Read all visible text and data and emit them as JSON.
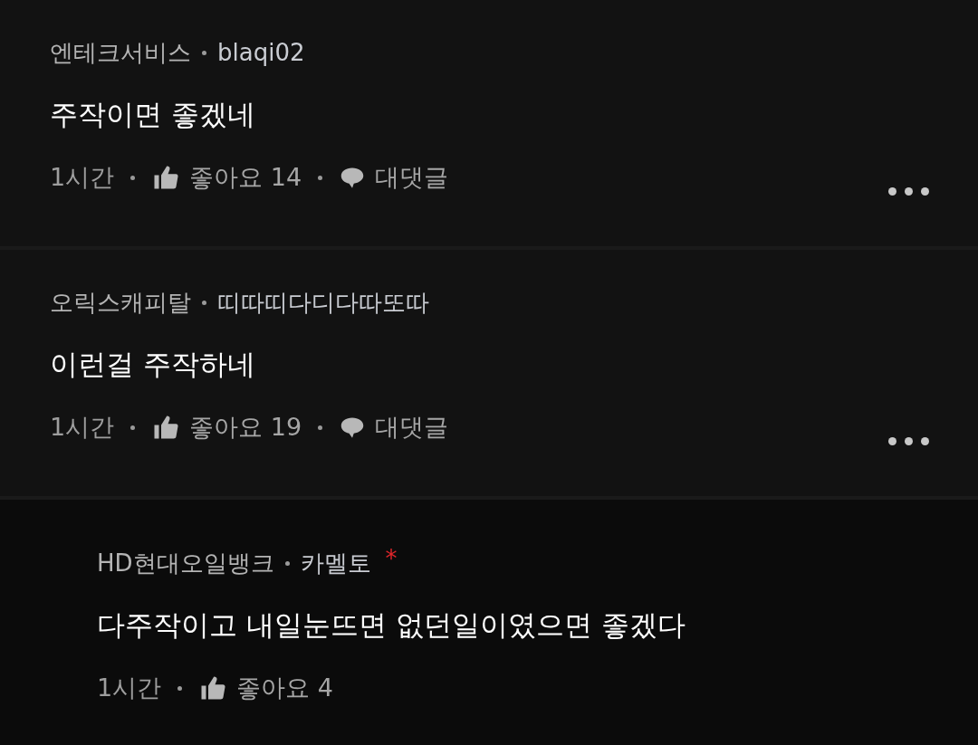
{
  "comments": [
    {
      "kind": "comment",
      "company": "엔테크서비스",
      "author": "blaqi02",
      "text": "주작이면 좋겠네",
      "time": "1시간",
      "likes": "좋아요 14",
      "reply_label": "대댓글"
    },
    {
      "kind": "comment",
      "company": "오릭스캐피탈",
      "author": "띠따띠다디다따또따",
      "text": "이런걸 주작하네",
      "time": "1시간",
      "likes": "좋아요 19",
      "reply_label": "대댓글"
    },
    {
      "kind": "reply",
      "company": "HD현대오일뱅크",
      "author": "카멜토",
      "badge": "*",
      "text": "다주작이고 내일눈뜨면 없던일이였으면 좋겠다",
      "time": "1시간",
      "likes": "좋아요 4"
    }
  ]
}
